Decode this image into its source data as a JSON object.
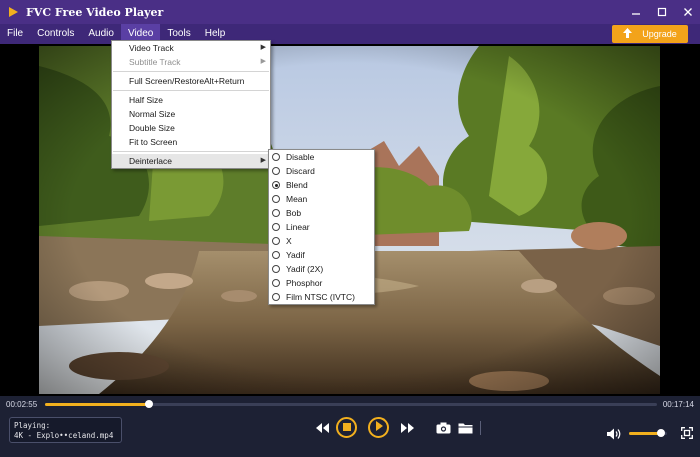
{
  "window": {
    "title": "FVC Free Video Player"
  },
  "menubar": {
    "items": [
      {
        "label": "File"
      },
      {
        "label": "Controls"
      },
      {
        "label": "Audio"
      },
      {
        "label": "Video"
      },
      {
        "label": "Tools"
      },
      {
        "label": "Help"
      }
    ],
    "open_menu": "Video",
    "upgrade_label": "Upgrade"
  },
  "video_menu": {
    "video_track": "Video Track",
    "subtitle_track": "Subtitle Track",
    "full_screen": "Full Screen/Restore",
    "full_screen_shortcut": "Alt+Return",
    "half_size": "Half Size",
    "normal_size": "Normal Size",
    "double_size": "Double Size",
    "fit_to_screen": "Fit to Screen",
    "deinterlace": "Deinterlace"
  },
  "deinterlace_menu": {
    "options": [
      "Disable",
      "Discard",
      "Blend",
      "Mean",
      "Bob",
      "Linear",
      "X",
      "Yadif",
      "Yadif (2X)",
      "Phosphor",
      "Film NTSC (IVTC)"
    ],
    "selected": "Blend"
  },
  "playback": {
    "elapsed": "00:02:55",
    "total": "00:17:14",
    "progress": 0.17,
    "now_playing_label": "Playing:",
    "now_playing_file": "4K - Explo••celand.mp4",
    "volume": 0.85
  },
  "colors": {
    "titlebar": "#4a2f86",
    "menubar": "#3e2878",
    "accent": "#f2b01e",
    "upgrade": "#f3a31a",
    "controls_bg": "#1d2134"
  },
  "icons": {
    "app": "fvc-logo-icon",
    "minimize": "minimize-icon",
    "maximize": "maximize-icon",
    "close": "close-icon",
    "upgrade": "arrow-up-icon",
    "rewind": "rewind-icon",
    "stop": "stop-icon",
    "play": "play-icon",
    "forward": "fast-forward-icon",
    "snapshot": "camera-icon",
    "open": "folder-icon",
    "volume": "speaker-icon",
    "fullscreen": "fullscreen-icon"
  }
}
